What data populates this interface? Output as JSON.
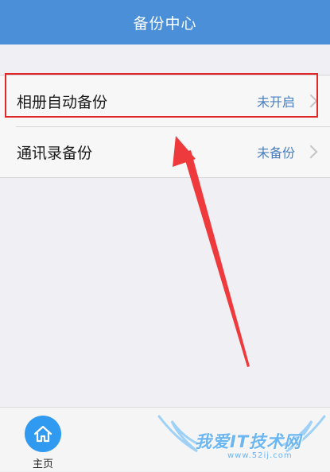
{
  "header": {
    "title": "备份中心"
  },
  "backup_list": {
    "items": [
      {
        "label": "相册自动备份",
        "status": "未开启"
      },
      {
        "label": "通讯录备份",
        "status": "未备份"
      }
    ]
  },
  "bottom_bar": {
    "home_label": "主页"
  },
  "watermark": {
    "text": "我爱IT技术网",
    "url": "www.52ij.com"
  },
  "colors": {
    "header_bg": "#4a8fd8",
    "status_text": "#4a7fc0",
    "annotation": "#e0282b",
    "home_button": "#2f9af0"
  },
  "icons": {
    "row_arrow": "chevron-right-icon",
    "home": "home-icon"
  }
}
